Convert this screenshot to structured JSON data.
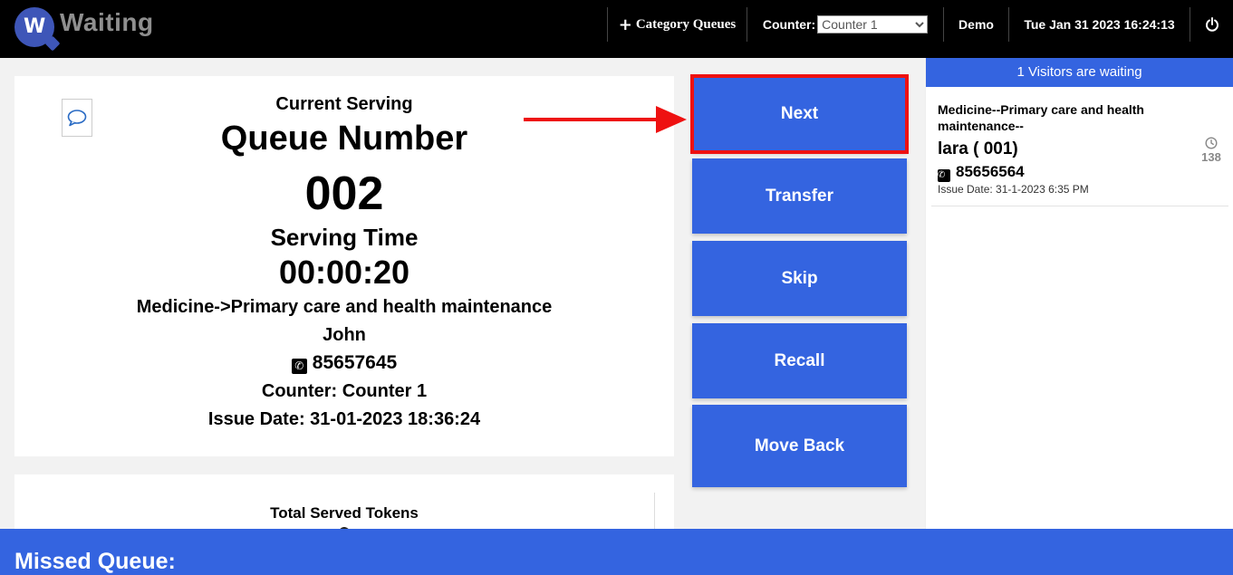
{
  "app": {
    "logo_letter": "W",
    "logo_text": "Waiting"
  },
  "nav": {
    "category_plus": "+",
    "category_label": "Category Queues",
    "counter_label": "Counter:",
    "counter_selected": "Counter 1",
    "user": "Demo",
    "datetime": "Tue Jan 31 2023 16:24:13"
  },
  "serving": {
    "current_label": "Current Serving",
    "queue_label": "Queue Number",
    "queue_number": "002",
    "serving_time_label": "Serving Time",
    "serving_time": "00:00:20",
    "category": "Medicine->Primary care and health maintenance",
    "name": "John",
    "phone": "85657645",
    "counter": "Counter: Counter 1",
    "issue_date": "Issue Date: 31-01-2023 18:36:24"
  },
  "tokens": {
    "label": "Total Served Tokens"
  },
  "actions": {
    "next": "Next",
    "transfer": "Transfer",
    "skip": "Skip",
    "recall": "Recall",
    "move_back": "Move Back"
  },
  "waiting": {
    "header": "1 Visitors are waiting",
    "items": [
      {
        "category": "Medicine--Primary care and health maintenance--",
        "name": "lara ( 001)",
        "phone": "85656564",
        "issue_date": "Issue Date: 31-1-2023 6:35 PM",
        "wait_count": "138"
      }
    ]
  },
  "missed": {
    "title": "Missed Queue:"
  },
  "colors": {
    "primary": "#3464e0",
    "topbar": "#000000",
    "highlight": "#ee1111"
  }
}
